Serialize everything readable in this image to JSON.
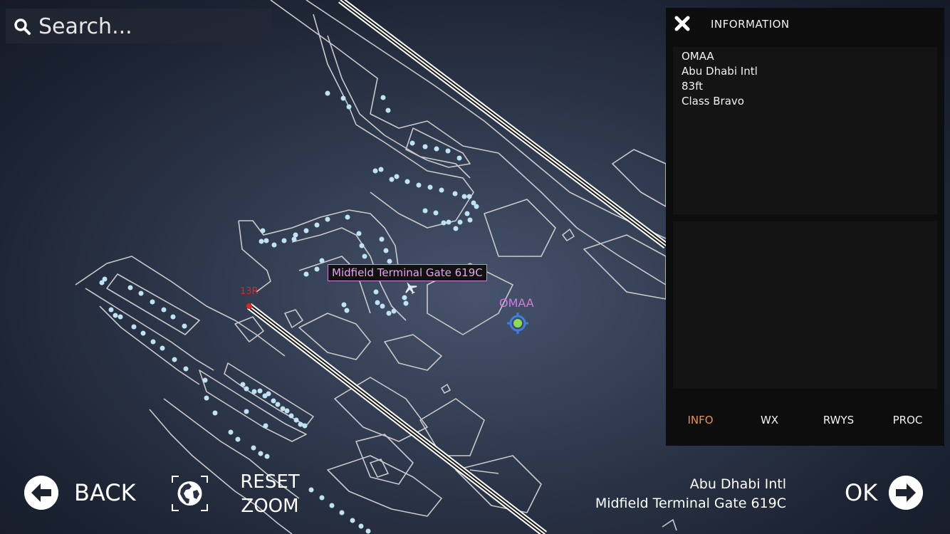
{
  "search": {
    "placeholder": "Search...",
    "icon": "search-icon"
  },
  "panel": {
    "title": "INFORMATION",
    "close_icon": "close-icon",
    "info_lines": [
      "OMAA",
      "Abu Dhabi Intl",
      "83ft",
      "Class Bravo"
    ],
    "tabs": [
      {
        "label": "INFO",
        "active": true
      },
      {
        "label": "WX",
        "active": false
      },
      {
        "label": "RWYS",
        "active": false
      },
      {
        "label": "PROC",
        "active": false
      }
    ]
  },
  "map": {
    "tooltip": "Midfield Terminal Gate 619C",
    "airport_label": "OMAA",
    "runway_label": "13R",
    "colors": {
      "runway_marker": "#e02424",
      "airport_label": "#d478e0",
      "gate_dot": "#bfe3f2",
      "outline": "#c4c4c4"
    }
  },
  "footer": {
    "back_label": "BACK",
    "reset_zoom_label": [
      "RESET",
      "ZOOM"
    ],
    "destination_airport": "Abu Dhabi Intl",
    "destination_gate": "Midfield Terminal Gate 619C",
    "ok_label": "OK"
  },
  "accent_color": "#e8944a"
}
